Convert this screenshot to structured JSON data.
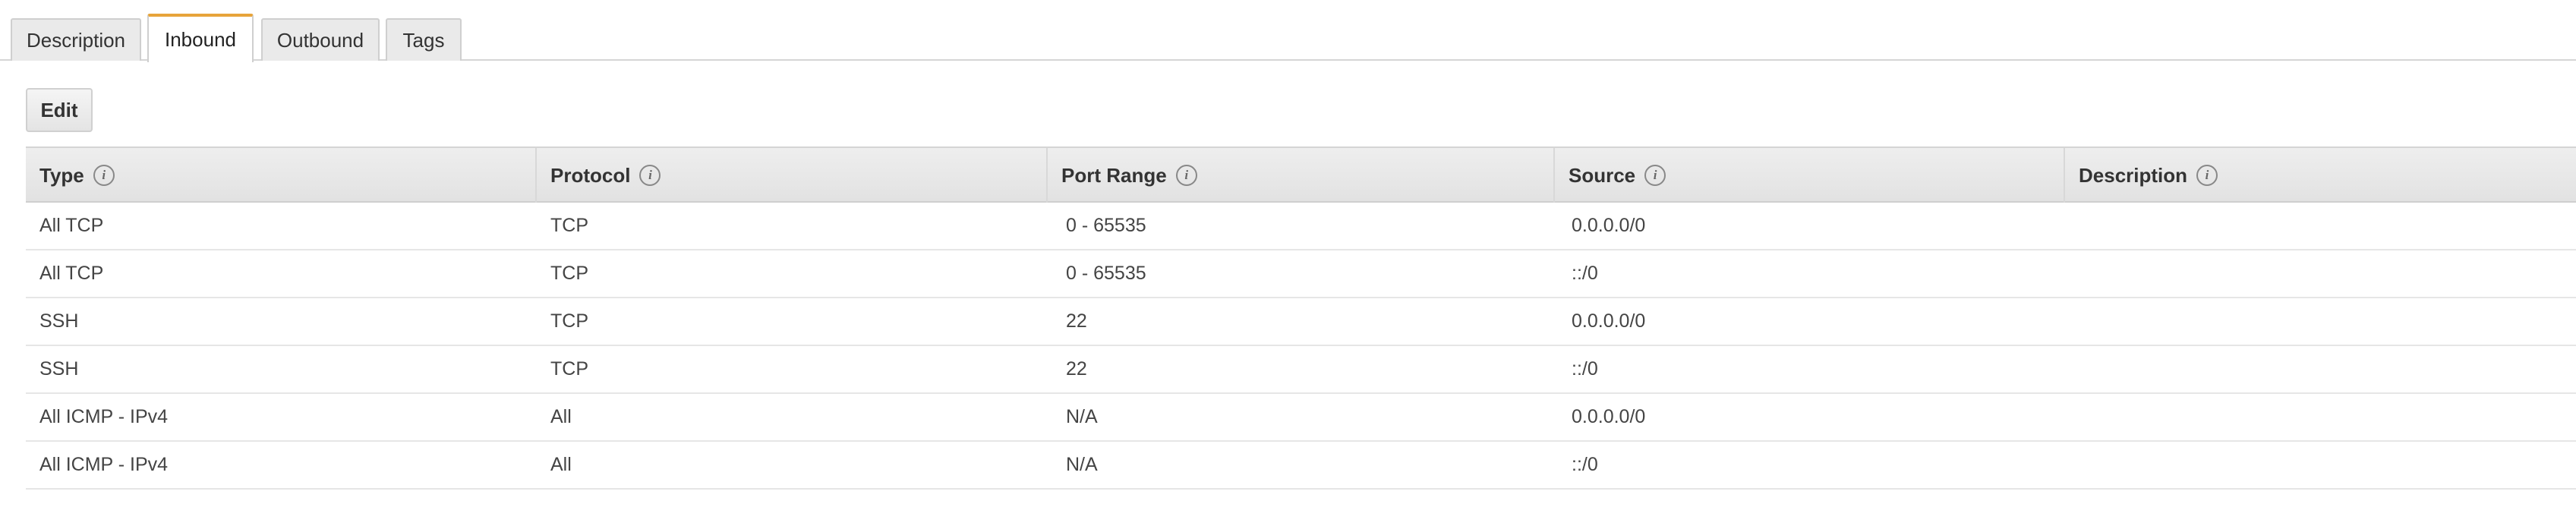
{
  "tabs": [
    {
      "label": "Description",
      "active": false
    },
    {
      "label": "Inbound",
      "active": true
    },
    {
      "label": "Outbound",
      "active": false
    },
    {
      "label": "Tags",
      "active": false
    }
  ],
  "toolbar": {
    "edit_label": "Edit"
  },
  "colors": {
    "active_tab_accent": "#e7a43a",
    "header_bg": "#e6e6e6",
    "text": "#444444"
  },
  "table": {
    "columns": [
      "Type",
      "Protocol",
      "Port Range",
      "Source",
      "Description"
    ],
    "info_icon": "i",
    "rows": [
      [
        "All TCP",
        "TCP",
        "0 - 65535",
        "0.0.0.0/0",
        ""
      ],
      [
        "All TCP",
        "TCP",
        "0 - 65535",
        "::/0",
        ""
      ],
      [
        "SSH",
        "TCP",
        "22",
        "0.0.0.0/0",
        ""
      ],
      [
        "SSH",
        "TCP",
        "22",
        "::/0",
        ""
      ],
      [
        "All ICMP - IPv4",
        "All",
        "N/A",
        "0.0.0.0/0",
        ""
      ],
      [
        "All ICMP - IPv4",
        "All",
        "N/A",
        "::/0",
        ""
      ]
    ]
  }
}
